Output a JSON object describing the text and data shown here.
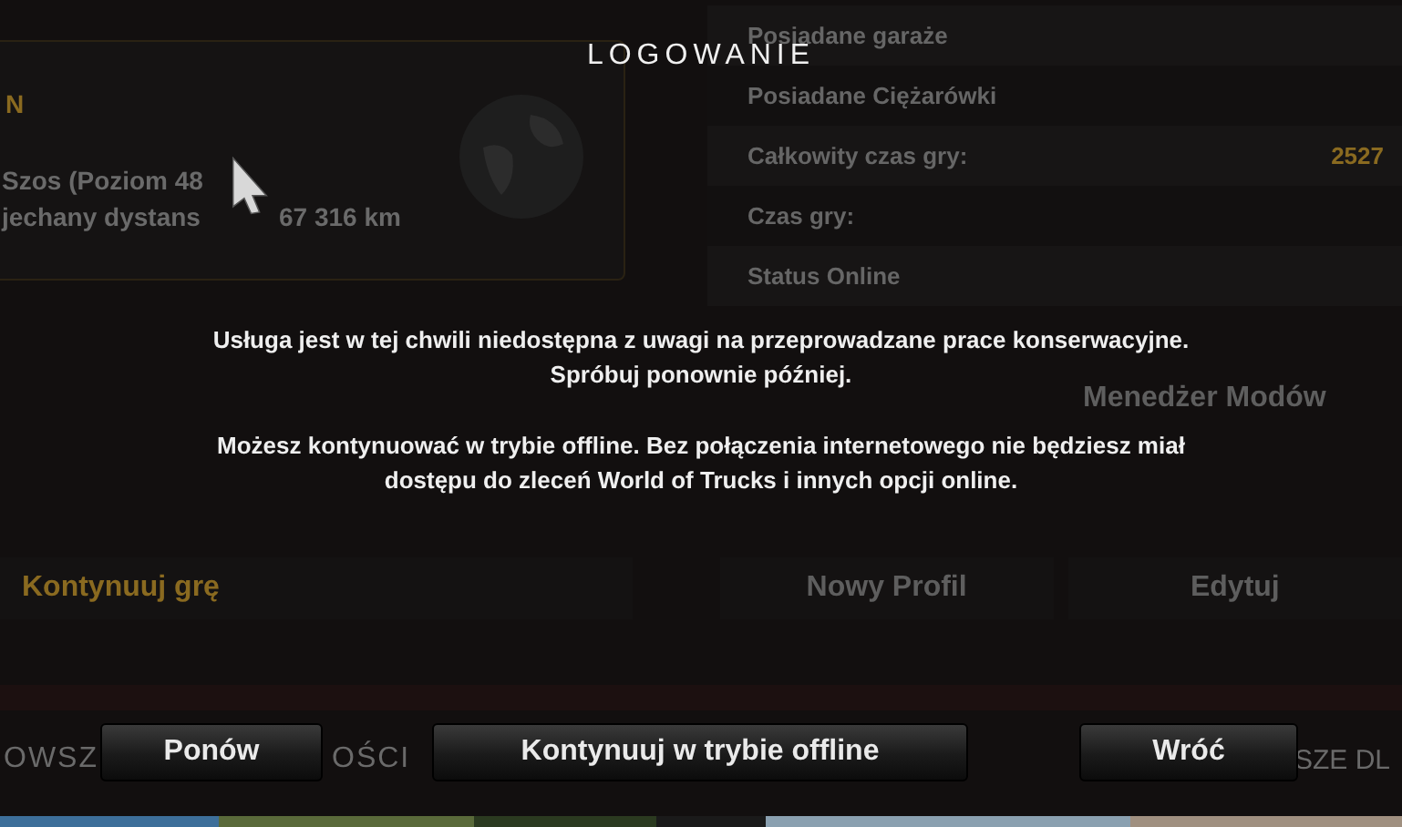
{
  "background": {
    "profile": {
      "heading": "N",
      "level_line": "Szos (Poziom 48",
      "distance_label": "jechany dystans",
      "distance": "67 316 km"
    },
    "stats": [
      {
        "label": "Posiadane garaże"
      },
      {
        "label": "Posiadane Ciężarówki"
      },
      {
        "label": "Całkowity czas gry:",
        "value": "2527"
      },
      {
        "label": "Czas gry:"
      },
      {
        "label": "Status Online"
      }
    ],
    "mod_manager": "Menedżer Modów",
    "buttons": [
      {
        "label": "Kontynuuj grę",
        "highlighted": true
      },
      {
        "label": "Nowy Profil",
        "highlighted": false
      },
      {
        "label": "Edytuj",
        "highlighted": false
      }
    ],
    "bottom_tabs": [
      "OWSZ",
      "OŚCI",
      "SZE DL"
    ]
  },
  "dialog": {
    "title": "LOGOWANIE",
    "paragraphs": [
      [
        "Usługa jest w tej chwili niedostępna z uwagi na przeprowadzane prace konserwacyjne.",
        "Spróbuj ponownie później."
      ],
      [
        "Możesz kontynuować w trybie offline. Bez połączenia internetowego nie będziesz miał",
        "dostępu do zleceń World of Trucks i innych opcji online."
      ]
    ],
    "buttons": [
      {
        "label": "Ponów"
      },
      {
        "label": "Kontynuuj w trybie offline"
      },
      {
        "label": "Wróć"
      }
    ]
  }
}
